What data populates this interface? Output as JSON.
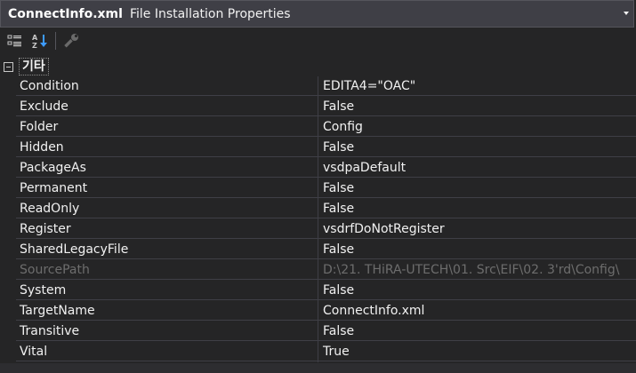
{
  "header": {
    "object_name": "ConnectInfo.xml",
    "object_type": "File Installation Properties"
  },
  "toolbar": {
    "buttons": [
      {
        "icon": "categorized-icon"
      },
      {
        "icon": "alphabetical-sort-icon"
      },
      {
        "icon": "property-pages-wrench-icon"
      }
    ]
  },
  "category": {
    "label": "기타",
    "state": "expanded"
  },
  "properties": [
    {
      "name": "Condition",
      "value": "EDITA4=\"OAC\""
    },
    {
      "name": "Exclude",
      "value": "False"
    },
    {
      "name": "Folder",
      "value": "Config"
    },
    {
      "name": "Hidden",
      "value": "False"
    },
    {
      "name": "PackageAs",
      "value": "vsdpaDefault"
    },
    {
      "name": "Permanent",
      "value": "False"
    },
    {
      "name": "ReadOnly",
      "value": "False"
    },
    {
      "name": "Register",
      "value": "vsdrfDoNotRegister"
    },
    {
      "name": "SharedLegacyFile",
      "value": "False"
    },
    {
      "name": "SourcePath",
      "value": "D:\\21. THiRA-UTECH\\01. Src\\EIF\\02. 3'rd\\Config\\",
      "disabled": true
    },
    {
      "name": "System",
      "value": "False"
    },
    {
      "name": "TargetName",
      "value": "ConnectInfo.xml"
    },
    {
      "name": "Transitive",
      "value": "False"
    },
    {
      "name": "Vital",
      "value": "True"
    }
  ],
  "colors": {
    "background": "#252526",
    "header_bg": "#3f3f46",
    "grid_line": "#3f3f46",
    "text": "#f1f1f1",
    "disabled_text": "#6d6d6d"
  }
}
